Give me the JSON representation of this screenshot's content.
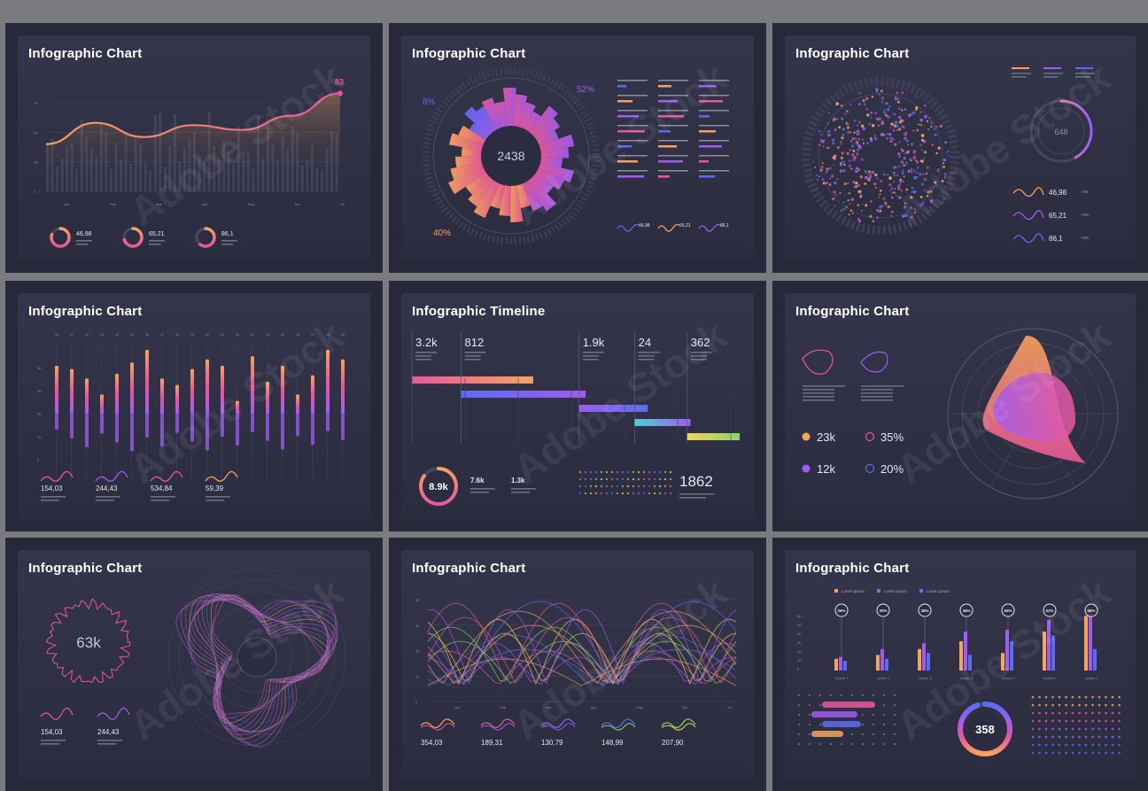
{
  "panels": [
    {
      "title": "Infographic Chart"
    },
    {
      "title": "Infographic Chart"
    },
    {
      "title": "Infographic Chart"
    },
    {
      "title": "Infographic Chart"
    },
    {
      "title": "Infographic Timeline"
    },
    {
      "title": "Infographic Chart"
    },
    {
      "title": "Infographic Chart"
    },
    {
      "title": "Infographic Chart"
    },
    {
      "title": "Infographic Chart"
    }
  ],
  "watermark": "Adobe Stock",
  "colors": {
    "orange": "#f7a35c",
    "pink": "#e9579a",
    "purple": "#a05cf0",
    "blue": "#5a6cf0",
    "green": "#8ad36a",
    "yellow": "#f5d25a"
  },
  "chart_data": [
    {
      "type": "line",
      "x": [
        "Jan",
        "Feb",
        "Mar",
        "Apr",
        "May",
        "Jun",
        "Jul"
      ],
      "values": [
        40,
        58,
        46,
        56,
        52,
        64,
        83
      ],
      "peak_label": "83",
      "stats": [
        {
          "value": "46,98",
          "fill": 0.8
        },
        {
          "value": "65,21",
          "fill": 0.7
        },
        {
          "value": "86,1",
          "fill": 0.6
        }
      ]
    },
    {
      "type": "pie",
      "center_value": "2438",
      "labels": [
        "8%",
        "52%",
        "40%"
      ],
      "slices": [
        8,
        52,
        40
      ],
      "stats": [
        "46,98",
        "65,21",
        "86,1"
      ]
    },
    {
      "type": "scatter",
      "gauge_value": "648",
      "stats": [
        "46,98",
        "65,21",
        "86,1"
      ],
      "stat_pcts": [
        "+4%",
        "+2%",
        "+2%"
      ]
    },
    {
      "type": "bar",
      "bars": [
        30,
        28,
        22,
        12,
        25,
        32,
        40,
        22,
        18,
        28,
        34,
        30,
        8,
        36,
        20,
        30,
        12,
        24,
        40,
        34
      ],
      "stats": [
        "154,03",
        "244,43",
        "534,84",
        "59,39"
      ]
    },
    {
      "type": "bar",
      "items": [
        {
          "value": "3.2k",
          "start": 0.0,
          "end": 0.37
        },
        {
          "value": "812",
          "start": 0.15,
          "end": 0.53
        },
        {
          "value": "1.9k",
          "start": 0.51,
          "end": 0.72
        },
        {
          "value": "24",
          "start": 0.68,
          "end": 0.85
        },
        {
          "value": "362",
          "start": 0.84,
          "end": 1.0
        }
      ],
      "ring_value": "8.9k",
      "stats": [
        "7.6k",
        "1.3k"
      ],
      "big_value": "1862"
    },
    {
      "type": "area",
      "stats": [
        {
          "value": "23k"
        },
        {
          "value": "35%"
        },
        {
          "value": "12k"
        },
        {
          "value": "20%"
        }
      ]
    },
    {
      "type": "line",
      "center_value": "63k",
      "stats": [
        "154,03",
        "244,43"
      ]
    },
    {
      "type": "line",
      "x": [
        "Jan",
        "Feb",
        "Mar",
        "Apr",
        "May",
        "Jun",
        "Jul"
      ],
      "stats": [
        "354,03",
        "189,31",
        "130,79",
        "148,99",
        "207,90"
      ]
    },
    {
      "type": "bar",
      "legend": [
        "Lorem ipsum",
        "Lorem ipsum",
        "Lorem ipsum"
      ],
      "groups": [
        {
          "label": "Option 1",
          "values": [
            12,
            14,
            10
          ],
          "pct": "26%"
        },
        {
          "label": "Option 2",
          "values": [
            16,
            22,
            12
          ],
          "pct": "30%"
        },
        {
          "label": "Option 3",
          "values": [
            22,
            28,
            18
          ],
          "pct": "38%"
        },
        {
          "label": "Option 4",
          "values": [
            30,
            40,
            16
          ],
          "pct": "45%"
        },
        {
          "label": "Option 5",
          "values": [
            18,
            42,
            30
          ],
          "pct": "50%"
        },
        {
          "label": "Option 6",
          "values": [
            40,
            52,
            36
          ],
          "pct": "52%"
        },
        {
          "label": "Option 7",
          "values": [
            56,
            60,
            22
          ],
          "pct": "58%"
        }
      ],
      "ring_value": "358"
    }
  ]
}
